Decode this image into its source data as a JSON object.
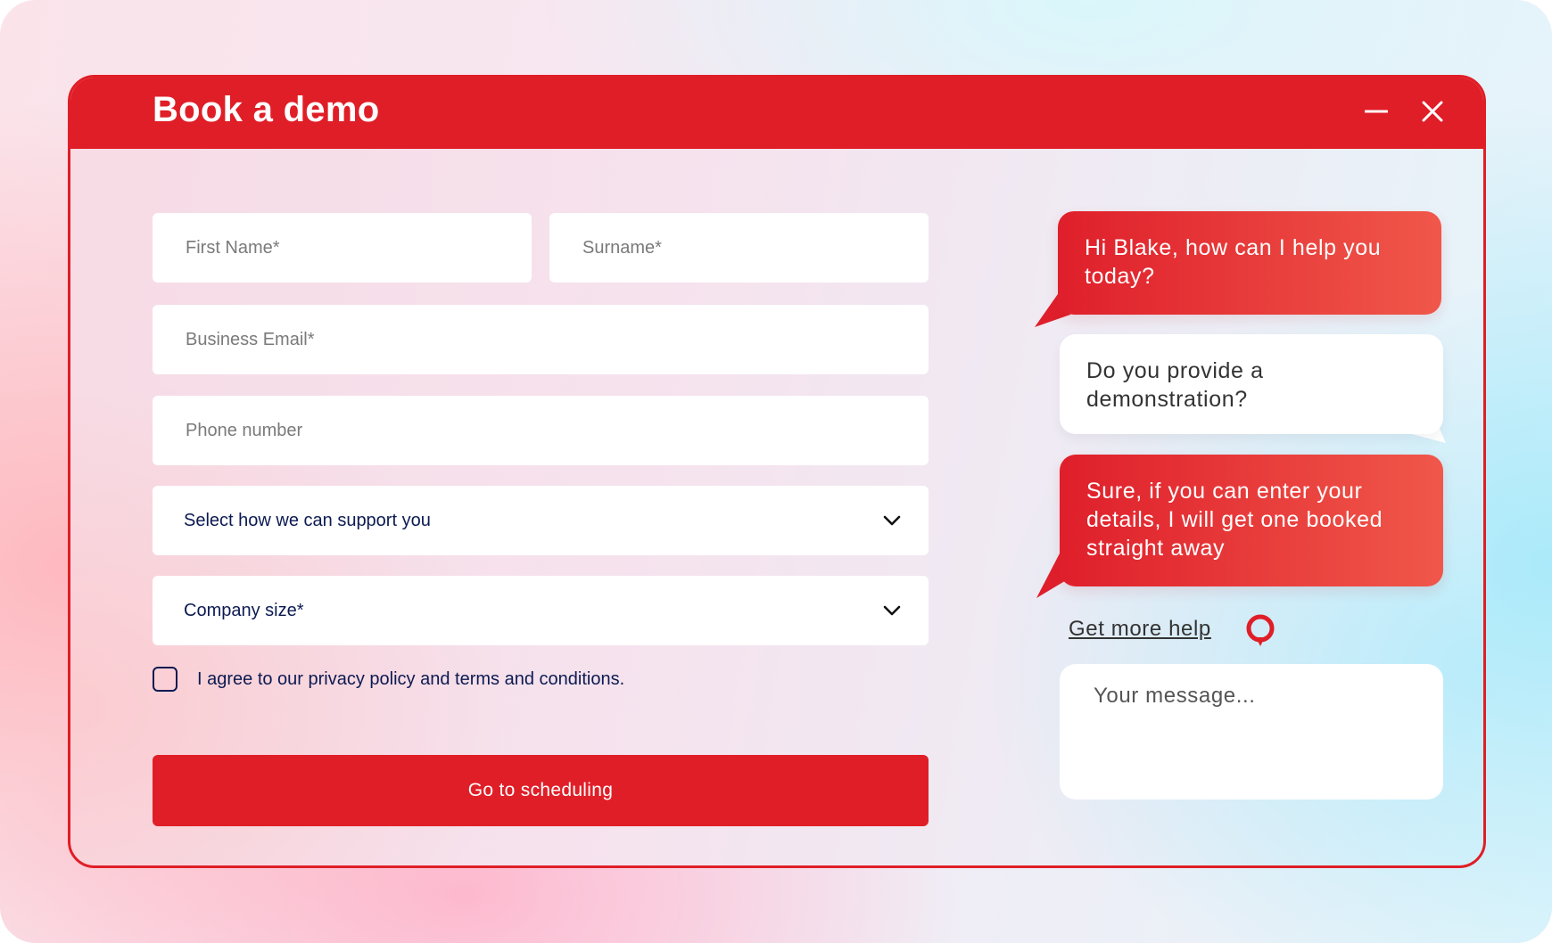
{
  "window": {
    "title": "Book a demo",
    "accent_color": "#e01e27",
    "minimize_icon": "minus-icon",
    "close_icon": "close-icon"
  },
  "form": {
    "first_name_placeholder": "First Name*",
    "surname_placeholder": "Surname*",
    "email_placeholder": "Business Email*",
    "phone_placeholder": "Phone number",
    "support_select": "Select how we can support you",
    "company_size_select": "Company size*",
    "select_icon": "chevron-down-icon",
    "agree_text": "I agree to our privacy policy and terms and conditions.",
    "agree_checked": false,
    "submit_label": "Go to scheduling"
  },
  "chat": {
    "messages": [
      {
        "from": "agent",
        "text": "Hi Blake, how can I help you today?"
      },
      {
        "from": "user",
        "text": "Do you provide a demonstration?"
      },
      {
        "from": "agent",
        "text": "Sure, if you can enter your details, I will get one booked straight away"
      }
    ],
    "help_link": "Get more help",
    "help_icon": "chat-bubble-icon",
    "message_placeholder": "Your message..."
  }
}
